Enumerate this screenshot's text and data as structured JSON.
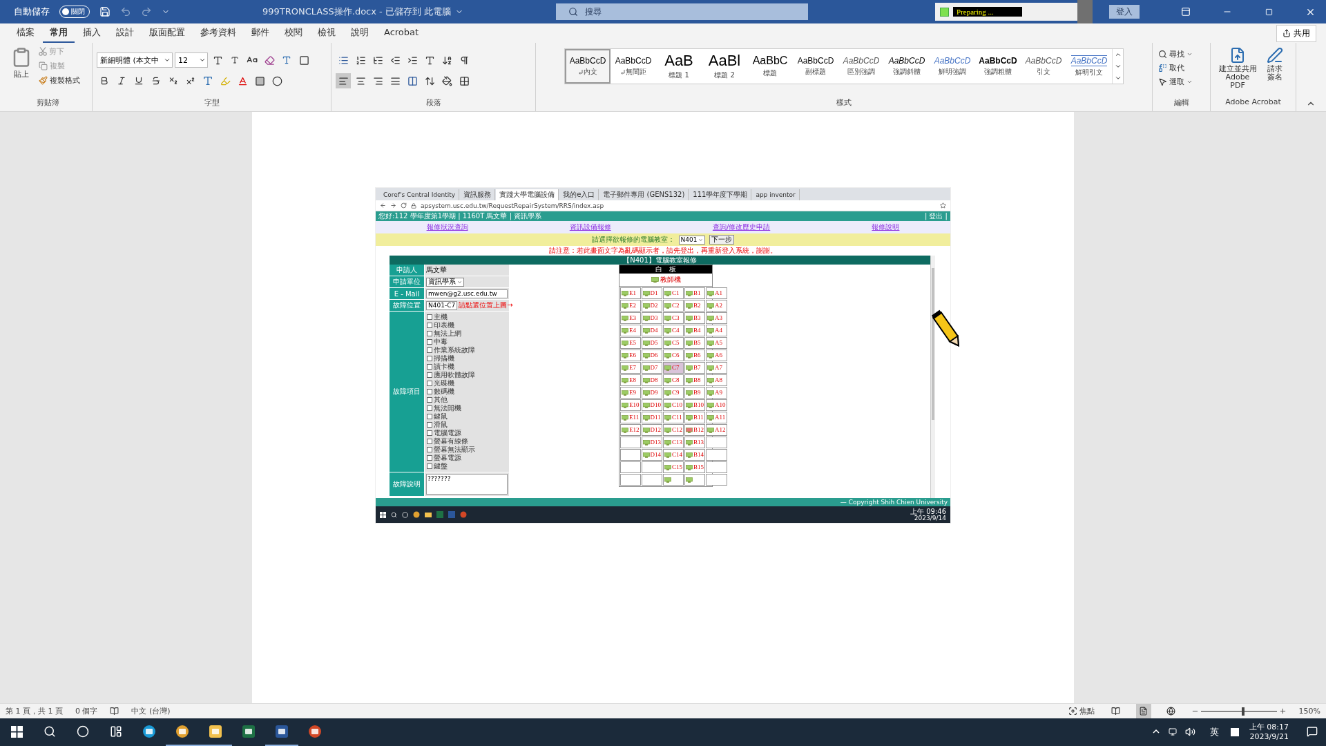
{
  "title_bar": {
    "autosave_label": "自動儲存",
    "autosave_toggle": {
      "label": "關閉",
      "on": false
    },
    "window_title": "999TRONCLASS操作.docx - 已儲存到 此電腦",
    "search": {
      "placeholder": "搜尋"
    },
    "recorder": {
      "status": "Preparing ..."
    },
    "sign_in": "登入"
  },
  "ribbon_tabs": [
    {
      "label": "檔案",
      "selected": false
    },
    {
      "label": "常用",
      "selected": true
    },
    {
      "label": "插入",
      "selected": false
    },
    {
      "label": "設計",
      "selected": false
    },
    {
      "label": "版面配置",
      "selected": false
    },
    {
      "label": "參考資料",
      "selected": false
    },
    {
      "label": "郵件",
      "selected": false
    },
    {
      "label": "校閱",
      "selected": false
    },
    {
      "label": "檢視",
      "selected": false
    },
    {
      "label": "說明",
      "selected": false
    },
    {
      "label": "Acrobat",
      "selected": false
    }
  ],
  "share_button": "共用",
  "clipboard": {
    "paste": "貼上",
    "cut": "剪下",
    "copy": "複製",
    "format_painter": "複製格式",
    "group_label": "剪貼簿"
  },
  "font": {
    "font_name": "新細明體 (本文中",
    "font_size": "12",
    "group_label": "字型"
  },
  "paragraph": {
    "group_label": "段落"
  },
  "styles": {
    "group_label": "樣式",
    "items": [
      {
        "preview": "AaBbCcD",
        "name": "內文",
        "kind": "normal",
        "selected": true
      },
      {
        "preview": "AaBbCcD",
        "name": "無間距",
        "kind": "normal",
        "selected": false
      },
      {
        "preview": "AaB",
        "name": "標題 1",
        "kind": "heading",
        "selected": false
      },
      {
        "preview": "AaBl",
        "name": "標題 2",
        "kind": "heading",
        "selected": false
      },
      {
        "preview": "AaBbC",
        "name": "標題",
        "kind": "title",
        "selected": false
      },
      {
        "preview": "AaBbCcD",
        "name": "副標題",
        "kind": "plain",
        "selected": false
      },
      {
        "preview": "AaBbCcD",
        "name": "區別強調",
        "kind": "subtle",
        "selected": false
      },
      {
        "preview": "AaBbCcD",
        "name": "強調斜體",
        "kind": "emphasis",
        "selected": false
      },
      {
        "preview": "AaBbCcD",
        "name": "鮮明強調",
        "kind": "intense",
        "selected": false
      },
      {
        "preview": "AaBbCcD",
        "name": "強調粗體",
        "kind": "strong",
        "selected": false
      },
      {
        "preview": "AaBbCcD",
        "name": "引文",
        "kind": "subtle",
        "selected": false
      },
      {
        "preview": "AaBbCcD",
        "name": "鮮明引文",
        "kind": "intense-quote",
        "selected": false
      }
    ]
  },
  "editing": {
    "find": "尋找",
    "replace": "取代",
    "select": "選取",
    "group_label": "編輯"
  },
  "acrobat": {
    "create_pdf": "建立並共用 Adobe PDF",
    "request_signature": "請求簽名",
    "group_label": "Adobe Acrobat"
  },
  "embedded_screenshot": {
    "browser_tabs": [
      {
        "title": "Coref's Central Identity",
        "selected": false
      },
      {
        "title": "資訊服務",
        "selected": false
      },
      {
        "title": "實踐大學電腦設備",
        "selected": true
      },
      {
        "title": "我的e入口",
        "selected": false
      },
      {
        "title": "電子郵件專用 (GENS132)",
        "selected": false
      },
      {
        "title": "111學年度下學期",
        "selected": false
      },
      {
        "title": "app inventor",
        "selected": false
      }
    ],
    "address": "apsystem.usc.edu.tw/RequestRepairSystem/RRS/index.asp",
    "user_bar": "您好:112 學年度第1學期 | 1160T 馬文華 | 資訊學系",
    "logout": "| 登出 |",
    "nav_links": [
      "報修狀況查詢",
      "資訊設備報修",
      "查詢/修改歷史申請",
      "報修說明"
    ],
    "room_prompt": "請選擇欲報修的電腦教室：",
    "room_select": "N401",
    "next_button": "下一步",
    "notice": "請注意：若此畫面文字為亂碼顯示者，請先登出，再重新登入系統，謝謝。",
    "form_title": "【N401】電腦教室報修",
    "form": {
      "applicant_label": "申請人",
      "applicant": "馬文華",
      "unit_label": "申請單位",
      "unit": "資訊學系",
      "email_label": "E - Mail",
      "email": "mwen@g2.usc.edu.tw",
      "location_label": "故障位置",
      "location": "N401-C7",
      "location_hint": "請點選位置上圖→",
      "items_label": "故障項目",
      "fault_items": [
        {
          "label": "主機",
          "checked": false
        },
        {
          "label": "印表機",
          "checked": false
        },
        {
          "label": "無法上網",
          "checked": false
        },
        {
          "label": "中毒",
          "checked": false
        },
        {
          "label": "作業系統故障",
          "checked": false
        },
        {
          "label": "掃描機",
          "checked": false
        },
        {
          "label": "讀卡機",
          "checked": false
        },
        {
          "label": "應用軟體故障",
          "checked": false
        },
        {
          "label": "光碟機",
          "checked": false
        },
        {
          "label": "數碼機",
          "checked": false
        },
        {
          "label": "其他",
          "checked": false
        },
        {
          "label": "無法開機",
          "checked": false
        },
        {
          "label": "鍵鼠",
          "checked": false
        },
        {
          "label": "滑鼠",
          "checked": false
        },
        {
          "label": "電腦電源",
          "checked": false
        },
        {
          "label": "螢幕有線條",
          "checked": false
        },
        {
          "label": "螢幕無法顯示",
          "checked": false
        },
        {
          "label": "螢幕電源",
          "checked": false
        },
        {
          "label": "鍵盤",
          "checked": false
        }
      ],
      "description_label": "故障說明",
      "description": "???????"
    },
    "seat_map": {
      "board": "白　板",
      "teacher": "教師機",
      "rows": [
        [
          {
            "label": "E1",
            "kind": "pc",
            "selected": false
          },
          {
            "label": "D1",
            "kind": "pc",
            "selected": false
          },
          {
            "label": "C1",
            "kind": "pc",
            "selected": false
          },
          {
            "label": "B1",
            "kind": "pc",
            "selected": false
          },
          {
            "label": "A1",
            "kind": "pc",
            "selected": false
          }
        ],
        [
          {
            "label": "E2",
            "kind": "pc",
            "selected": false
          },
          {
            "label": "D2",
            "kind": "pc",
            "selected": false
          },
          {
            "label": "C2",
            "kind": "pc",
            "selected": false
          },
          {
            "label": "B2",
            "kind": "pc",
            "selected": false
          },
          {
            "label": "A2",
            "kind": "pc",
            "selected": false
          }
        ],
        [
          {
            "label": "E3",
            "kind": "pc",
            "selected": false
          },
          {
            "label": "D3",
            "kind": "pc",
            "selected": false
          },
          {
            "label": "C3",
            "kind": "pc",
            "selected": false
          },
          {
            "label": "B3",
            "kind": "pc",
            "selected": false
          },
          {
            "label": "A3",
            "kind": "pc",
            "selected": false
          }
        ],
        [
          {
            "label": "E4",
            "kind": "pc",
            "selected": false
          },
          {
            "label": "D4",
            "kind": "pc",
            "selected": false
          },
          {
            "label": "C4",
            "kind": "pc",
            "selected": false
          },
          {
            "label": "B4",
            "kind": "pc",
            "selected": false
          },
          {
            "label": "A4",
            "kind": "pc",
            "selected": false
          }
        ],
        [
          {
            "label": "E5",
            "kind": "pc",
            "selected": false
          },
          {
            "label": "D5",
            "kind": "pc",
            "selected": false
          },
          {
            "label": "C5",
            "kind": "pc",
            "selected": false
          },
          {
            "label": "B5",
            "kind": "pc",
            "selected": false
          },
          {
            "label": "A5",
            "kind": "pc",
            "selected": false
          }
        ],
        [
          {
            "label": "E6",
            "kind": "pc",
            "selected": false
          },
          {
            "label": "D6",
            "kind": "pc",
            "selected": false
          },
          {
            "label": "C6",
            "kind": "pc",
            "selected": false
          },
          {
            "label": "B6",
            "kind": "pc",
            "selected": false
          },
          {
            "label": "A6",
            "kind": "pc",
            "selected": false
          }
        ],
        [
          {
            "label": "E7",
            "kind": "pc",
            "selected": false
          },
          {
            "label": "D7",
            "kind": "pc",
            "selected": false
          },
          {
            "label": "C7",
            "kind": "pc",
            "selected": true
          },
          {
            "label": "B7",
            "kind": "pc",
            "selected": false
          },
          {
            "label": "A7",
            "kind": "pc",
            "selected": false
          }
        ],
        [
          {
            "label": "E8",
            "kind": "pc",
            "selected": false
          },
          {
            "label": "D8",
            "kind": "pc",
            "selected": false
          },
          {
            "label": "C8",
            "kind": "pc",
            "selected": false
          },
          {
            "label": "B8",
            "kind": "pc",
            "selected": false
          },
          {
            "label": "A8",
            "kind": "pc",
            "selected": false
          }
        ],
        [
          {
            "label": "E9",
            "kind": "pc",
            "selected": false
          },
          {
            "label": "D9",
            "kind": "pc",
            "selected": false
          },
          {
            "label": "C9",
            "kind": "pc",
            "selected": false
          },
          {
            "label": "B9",
            "kind": "pc",
            "selected": false
          },
          {
            "label": "A9",
            "kind": "pc",
            "selected": false
          }
        ],
        [
          {
            "label": "E10",
            "kind": "pc",
            "selected": false
          },
          {
            "label": "D10",
            "kind": "pc",
            "selected": false
          },
          {
            "label": "C10",
            "kind": "pc",
            "selected": false
          },
          {
            "label": "B10",
            "kind": "pc",
            "selected": false
          },
          {
            "label": "A10",
            "kind": "pc",
            "selected": false
          }
        ],
        [
          {
            "label": "E11",
            "kind": "pc",
            "selected": false
          },
          {
            "label": "D11",
            "kind": "pc",
            "selected": false
          },
          {
            "label": "C11",
            "kind": "pc",
            "selected": false
          },
          {
            "label": "B11",
            "kind": "pc",
            "selected": false
          },
          {
            "label": "A11",
            "kind": "pc",
            "selected": false
          }
        ],
        [
          {
            "label": "E12",
            "kind": "pc",
            "selected": false
          },
          {
            "label": "D12",
            "kind": "pc",
            "selected": false
          },
          {
            "label": "C12",
            "kind": "pc",
            "selected": false
          },
          {
            "label": "B12",
            "kind": "fault",
            "selected": false
          },
          {
            "label": "A12",
            "kind": "pc",
            "selected": false
          }
        ],
        [
          {
            "kind": "empty"
          },
          {
            "label": "D13",
            "kind": "pc",
            "selected": false
          },
          {
            "label": "C13",
            "kind": "pc",
            "selected": false
          },
          {
            "label": "B13",
            "kind": "pc",
            "selected": false
          },
          {
            "kind": "empty"
          }
        ],
        [
          {
            "kind": "empty"
          },
          {
            "label": "D14",
            "kind": "pc",
            "selected": false
          },
          {
            "label": "C14",
            "kind": "pc",
            "selected": false
          },
          {
            "label": "B14",
            "kind": "pc",
            "selected": false
          },
          {
            "kind": "empty"
          }
        ],
        [
          {
            "kind": "empty"
          },
          {
            "kind": "empty"
          },
          {
            "label": "C15",
            "kind": "pc",
            "selected": false
          },
          {
            "label": "B15",
            "kind": "pc",
            "selected": false
          },
          {
            "kind": "empty"
          }
        ],
        [
          {
            "kind": "empty"
          },
          {
            "kind": "empty"
          },
          {
            "kind": "pc",
            "selected": false
          },
          {
            "kind": "pc",
            "selected": false
          },
          {
            "kind": "empty"
          }
        ]
      ]
    },
    "copyright": "— Copyright Shih Chien University",
    "taskbar": {
      "time": "上午 09:46",
      "date": "2023/9/14"
    }
  },
  "status_bar": {
    "page": "第 1 頁，共 1 頁",
    "words": "0 個字",
    "language": "中文 (台灣)",
    "focus": "焦點",
    "zoom": "150%",
    "zoom_level": {
      "level": 0.56
    }
  },
  "taskbar": {
    "input_method": "英",
    "time": "上午 08:17",
    "date": "2023/9/21"
  }
}
